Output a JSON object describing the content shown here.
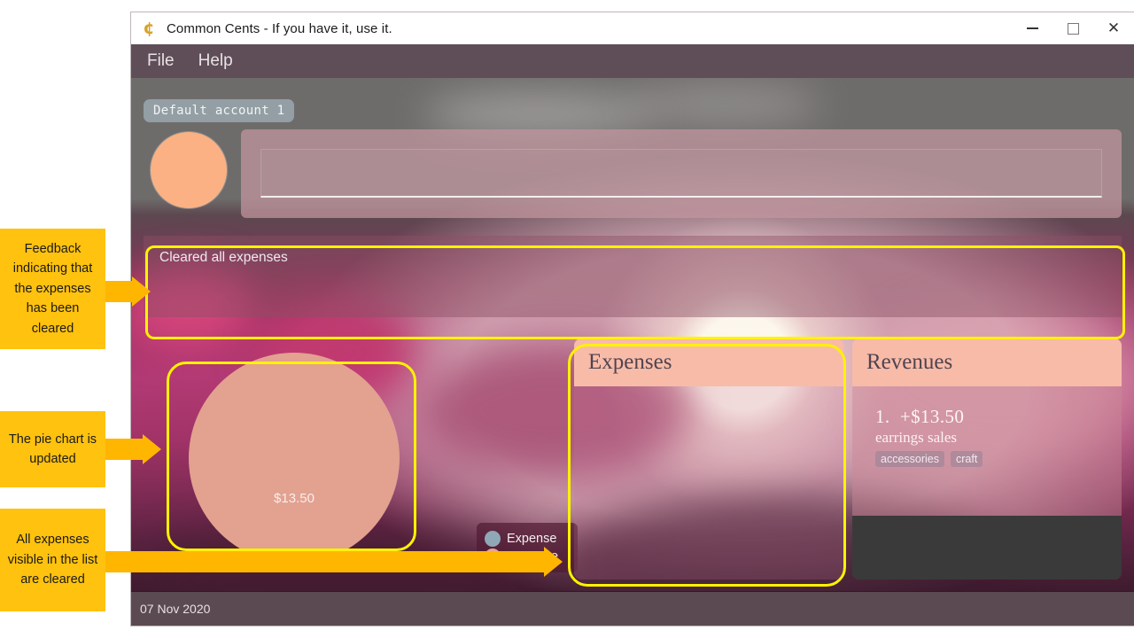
{
  "window": {
    "title": "Common Cents - If you have it, use it.",
    "icon": "cent-currency-icon",
    "controls": {
      "minimize": "–",
      "maximize": "□",
      "close": "✕"
    }
  },
  "menu": {
    "items": [
      "File",
      "Help"
    ]
  },
  "account": {
    "chip_label": "Default account 1"
  },
  "entry": {
    "input_value": "",
    "input_placeholder": ""
  },
  "feedback": {
    "message": "Cleared all expenses"
  },
  "pie": {
    "center_label": "$13.50",
    "legend": [
      {
        "label": "Expense",
        "color": "#8FA8B5"
      },
      {
        "label": "Revenue",
        "color": "#E8A391"
      }
    ]
  },
  "chart_data": {
    "type": "pie",
    "title": "",
    "categories": [
      "Expense",
      "Revenue"
    ],
    "values": [
      0,
      13.5
    ],
    "labels": [
      "$13.50"
    ],
    "colors": [
      "#8FA8B5",
      "#E3A190"
    ],
    "legend_position": "right",
    "annotations": [
      "$13.50"
    ]
  },
  "expenses": {
    "title": "Expenses",
    "entries": []
  },
  "revenues": {
    "title": "Revenues",
    "entries": [
      {
        "index": "1.",
        "amount": "+$13.50",
        "description": "earrings sales",
        "tags": [
          "accessories",
          "craft"
        ]
      }
    ]
  },
  "status": {
    "date": "07 Nov 2020"
  },
  "annotations": {
    "feedback_note": "Feedback indicating that the expenses has been cleared",
    "pie_note": "The pie chart is updated",
    "list_note": "All expenses visible in the list are cleared",
    "color": "#FFC20E"
  }
}
